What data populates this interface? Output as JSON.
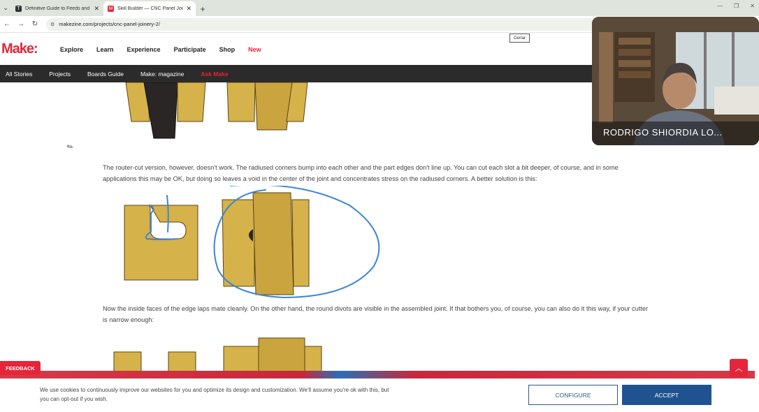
{
  "browser": {
    "tabs": [
      {
        "title": "Definitive Guide to Feeds and S",
        "favicon": "T",
        "favicon_color": "#333333"
      },
      {
        "title": "Skill Builder — CNC Panel Joine",
        "favicon": "M",
        "favicon_color": "#e4253a"
      }
    ],
    "url": "makezine.com/projects/cnc-panel-joinery-2/"
  },
  "site": {
    "logo": "Make:",
    "nav": [
      "Explore",
      "Learn",
      "Experience",
      "Participate",
      "Shop",
      "New"
    ],
    "subnav": [
      "All Stories",
      "Projects",
      "Boards Guide",
      "Make: magazine",
      "Ask Make"
    ],
    "brand_color": "#e4253a"
  },
  "tooltip": {
    "cerrar": "Cerrar"
  },
  "article": {
    "para1": "The router-cut version, however, doesn't work. The radiused corners bump into each other and the part edges don't line up. You can cut each slot a bit deeper, of course, and in some applications this may be OK, but doing so leaves a void in the center of the joint and concentrates stress on the radiused corners. A better solution is this:",
    "para2": "Now the inside faces of the edge laps mate cleanly. On the other hand, the round divots are visible in the assembled joint. If that bothers you, of course, you can also do it this way, if your cutter is narrow enough:"
  },
  "video": {
    "participant": "RODRIGO SHIORDIA LO..."
  },
  "feedback": {
    "label": "FEEDBACK"
  },
  "cookie": {
    "text": "We use cookies to continuously improve our websites for you and optimize its design and customization. We'll assume you're ok with this, but you can opt-out if you wish.",
    "configure": "CONFIGURE",
    "accept": "ACCEPT"
  }
}
